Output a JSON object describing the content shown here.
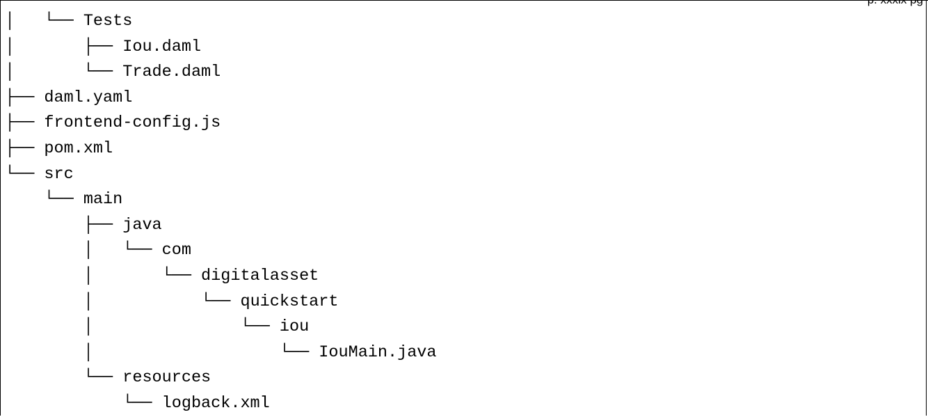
{
  "header": {
    "corner_text": "p. xxxix pg"
  },
  "tree": {
    "lines": [
      {
        "prefix": "│   └── ",
        "name": "Tests"
      },
      {
        "prefix": "│       ├── ",
        "name": "Iou.daml"
      },
      {
        "prefix": "│       └── ",
        "name": "Trade.daml"
      },
      {
        "prefix": "├── ",
        "name": "daml.yaml"
      },
      {
        "prefix": "├── ",
        "name": "frontend-config.js"
      },
      {
        "prefix": "├── ",
        "name": "pom.xml"
      },
      {
        "prefix": "└── ",
        "name": "src"
      },
      {
        "prefix": "    └── ",
        "name": "main"
      },
      {
        "prefix": "        ├── ",
        "name": "java"
      },
      {
        "prefix": "        │   └── ",
        "name": "com"
      },
      {
        "prefix": "        │       └── ",
        "name": "digitalasset"
      },
      {
        "prefix": "        │           └── ",
        "name": "quickstart"
      },
      {
        "prefix": "        │               └── ",
        "name": "iou"
      },
      {
        "prefix": "        │                   └── ",
        "name": "IouMain.java"
      },
      {
        "prefix": "        └── ",
        "name": "resources"
      },
      {
        "prefix": "            └── ",
        "name": "logback.xml"
      }
    ]
  }
}
